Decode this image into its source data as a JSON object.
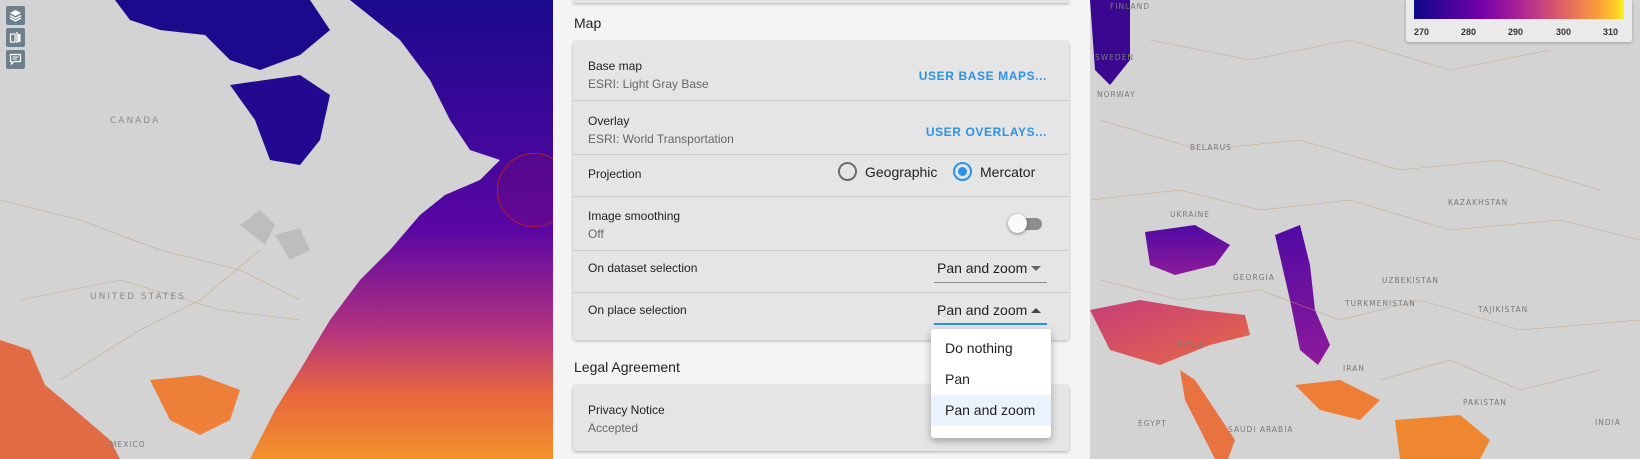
{
  "map": {
    "country_labels_large": [
      "CANADA",
      "UNITED STATES"
    ],
    "country_labels_small": [
      "FINLAND",
      "SWEDEN",
      "NORWAY",
      "BELARUS",
      "UKRAINE",
      "KAZAKHSTAN",
      "GEORGIA",
      "UZBEKISTAN",
      "TURKMENISTAN",
      "TAJIKISTAN",
      "SYRIA",
      "IRAN",
      "EGYPT",
      "SAUDI ARABIA",
      "PAKISTAN",
      "INDIA",
      "MEXICO"
    ],
    "tools": [
      "layers-icon",
      "split-icon",
      "comment-icon"
    ]
  },
  "legend": {
    "ticks": [
      "270",
      "280",
      "290",
      "300",
      "310"
    ]
  },
  "settings": {
    "map_section": {
      "title": "Map",
      "base_map": {
        "label": "Base map",
        "value": "ESRI: Light Gray Base",
        "action": "USER BASE MAPS..."
      },
      "overlay": {
        "label": "Overlay",
        "value": "ESRI: World Transportation",
        "action": "USER OVERLAYS..."
      },
      "projection": {
        "label": "Projection",
        "options": [
          "Geographic",
          "Mercator"
        ],
        "selected": "Mercator"
      },
      "image_smoothing": {
        "label": "Image smoothing",
        "value": "Off"
      },
      "on_dataset_selection": {
        "label": "On dataset selection",
        "value": "Pan and zoom"
      },
      "on_place_selection": {
        "label": "On place selection",
        "value": "Pan and zoom"
      }
    },
    "legal_section": {
      "title": "Legal Agreement",
      "privacy": {
        "label": "Privacy Notice",
        "value": "Accepted"
      }
    }
  },
  "dropdown": {
    "options": [
      "Do nothing",
      "Pan",
      "Pan and zoom"
    ],
    "selected": "Pan and zoom"
  },
  "colors": {
    "accent": "#2a93e6",
    "card_bg": "#e5e5e5",
    "marker": "#b0202a"
  }
}
